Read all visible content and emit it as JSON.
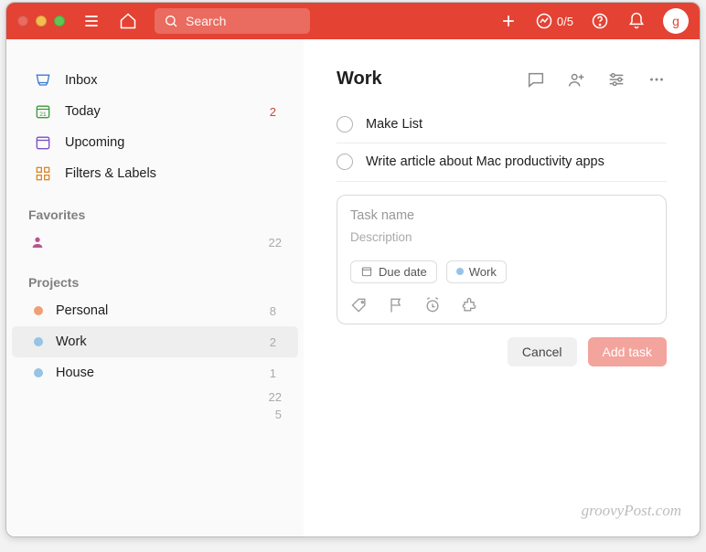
{
  "titlebar": {
    "search_placeholder": "Search",
    "productivity": "0/5",
    "avatar_letter": "g"
  },
  "nav": {
    "inbox": "Inbox",
    "today": "Today",
    "today_count": "2",
    "upcoming": "Upcoming",
    "filters": "Filters & Labels"
  },
  "sections": {
    "favorites": "Favorites",
    "projects": "Projects"
  },
  "favorites": {
    "count": "22"
  },
  "projects": [
    {
      "name": "Personal",
      "color": "#f29e75",
      "count": "8",
      "selected": false
    },
    {
      "name": "Work",
      "color": "#96c3e6",
      "count": "2",
      "selected": true
    },
    {
      "name": "House",
      "color": "#96c3e6",
      "count": "1",
      "selected": false
    }
  ],
  "trail_counts": [
    "22",
    "5"
  ],
  "main": {
    "title": "Work",
    "tasks": [
      "Make List",
      "Write article about Mac productivity apps"
    ],
    "editor": {
      "name_placeholder": "Task name",
      "desc_placeholder": "Description",
      "due_label": "Due date",
      "project_label": "Work"
    },
    "buttons": {
      "cancel": "Cancel",
      "add": "Add task"
    }
  },
  "watermark": "groovyPost.com",
  "colors": {
    "accent": "#e44233"
  }
}
